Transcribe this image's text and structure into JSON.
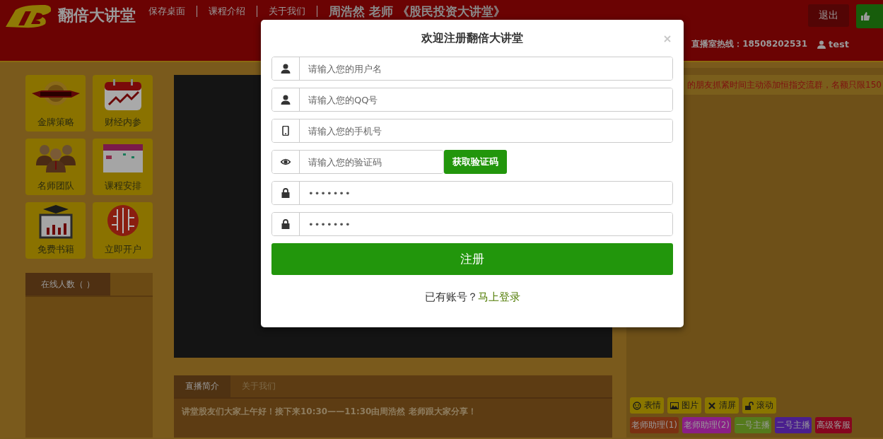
{
  "header": {
    "logo_text": "翻倍大讲堂",
    "nav": [
      "保存桌面",
      "课程介绍",
      "关于我们"
    ],
    "headline": "周浩然 老师 《股民投资大讲堂》",
    "hotline": "直播室热线：18508202531",
    "user": "test",
    "logout_button": "退出"
  },
  "tiles": [
    {
      "label": "金牌策略",
      "kind": "medal"
    },
    {
      "label": "财经内参",
      "kind": "calendar"
    },
    {
      "label": "名师团队",
      "kind": "team"
    },
    {
      "label": "课程安排",
      "kind": "schedule"
    },
    {
      "label": "免费书籍",
      "kind": "book"
    },
    {
      "label": "立即开户",
      "kind": "circuit"
    }
  ],
  "online_panel": {
    "tab": "在线人数（ ）"
  },
  "info_panel": {
    "tabs": [
      {
        "label": "直播简介",
        "selected": true
      },
      {
        "label": "关于我们",
        "selected": false
      }
    ],
    "text": "讲堂股友们大家上午好！接下来10:30——11:30由周浩然 老师跟大家分享！"
  },
  "notice": "的朋友抓紧时间主动添加恒指交流群，名额只限150",
  "chat_tools": [
    {
      "label": "表情",
      "kind": "smile"
    },
    {
      "label": "图片",
      "kind": "image"
    },
    {
      "label": "清屏",
      "kind": "clear"
    },
    {
      "label": "滚动",
      "kind": "lock"
    }
  ],
  "roles": [
    {
      "label": "老师助理(1)",
      "color": "#7a3112"
    },
    {
      "label": "老师助理(2)",
      "color": "#8a1f86"
    },
    {
      "label": "一号主播",
      "color": "#557a1c"
    },
    {
      "label": "二号主播",
      "color": "#4a1f8e"
    },
    {
      "label": "高级客服",
      "color": "#85061f"
    }
  ],
  "modal": {
    "title": "欢迎注册翻倍大讲堂",
    "fields": [
      {
        "kind": "user",
        "placeholder": "请输入您的用户名"
      },
      {
        "kind": "user",
        "placeholder": "请输入您的QQ号"
      },
      {
        "kind": "phone",
        "placeholder": "请输入您的手机号"
      },
      {
        "kind": "eye",
        "placeholder": "请输入您的验证码",
        "button": "获取验证码"
      },
      {
        "kind": "lock",
        "value": "•••••••"
      },
      {
        "kind": "lock",
        "value": "•••••••"
      }
    ],
    "submit": "注册",
    "footer_text": "已有账号？",
    "login_link": "马上登录"
  }
}
